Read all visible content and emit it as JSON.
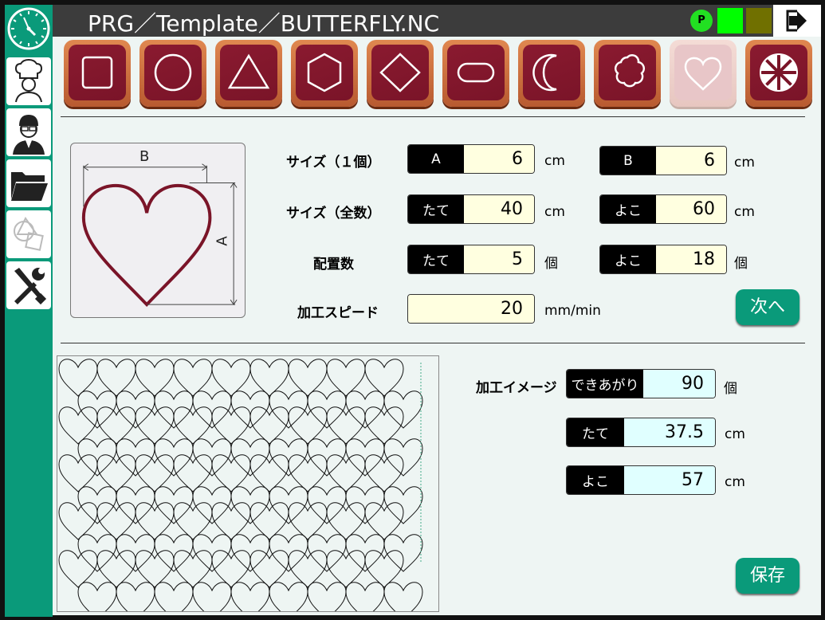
{
  "window": {
    "title": "PRG／Template／BUTTERFLY.NC"
  },
  "status": {
    "indicator_p": "P",
    "colors": {
      "p": "#22e022",
      "green": "#00ff00",
      "olive": "#707000"
    }
  },
  "sidebar": {
    "items": [
      {
        "icon": "clock-icon"
      },
      {
        "icon": "chef-icon"
      },
      {
        "icon": "operator-icon"
      },
      {
        "icon": "folder-icon"
      },
      {
        "icon": "shapes-icon"
      },
      {
        "icon": "tools-icon"
      }
    ]
  },
  "toolbar": {
    "shapes": [
      {
        "name": "square"
      },
      {
        "name": "circle"
      },
      {
        "name": "triangle"
      },
      {
        "name": "hexagon"
      },
      {
        "name": "diamond"
      },
      {
        "name": "rounded-rect"
      },
      {
        "name": "crescent"
      },
      {
        "name": "flower"
      },
      {
        "name": "heart",
        "selected": true
      },
      {
        "name": "wheel"
      }
    ]
  },
  "preview": {
    "label_a": "A",
    "label_b": "B"
  },
  "form": {
    "size_single": {
      "label": "サイズ（１個）",
      "a_tag": "A",
      "a_value": "6",
      "a_unit": "cm",
      "b_tag": "B",
      "b_value": "6",
      "b_unit": "cm"
    },
    "size_total": {
      "label": "サイズ（全数）",
      "h_tag": "たて",
      "h_value": "40",
      "h_unit": "cm",
      "w_tag": "よこ",
      "w_value": "60",
      "w_unit": "cm"
    },
    "layout_count": {
      "label": "配置数",
      "h_tag": "たて",
      "h_value": "5",
      "h_unit": "個",
      "w_tag": "よこ",
      "w_value": "18",
      "w_unit": "個"
    },
    "speed": {
      "label": "加工スピード",
      "value": "20",
      "unit": "mm/min"
    },
    "next_button": "次へ"
  },
  "result": {
    "label": "加工イメージ",
    "finished_tag": "できあがり",
    "finished_value": "90",
    "finished_unit": "個",
    "height_tag": "たて",
    "height_value": "37.5",
    "height_unit": "cm",
    "width_tag": "よこ",
    "width_value": "57",
    "width_unit": "cm"
  },
  "save_button": "保存"
}
